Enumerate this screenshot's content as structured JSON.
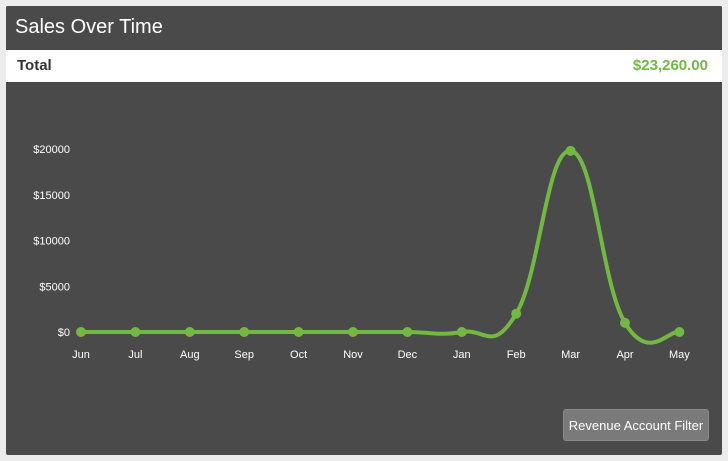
{
  "widget": {
    "title": "Sales Over Time",
    "total_label": "Total",
    "total_value": "$23,260.00",
    "filter_button_label": "Revenue Account Filter"
  },
  "colors": {
    "line": "#72b843",
    "panel": "#4a4a4a",
    "total_value": "#72b843"
  },
  "chart_data": {
    "type": "line",
    "title": "",
    "xlabel": "",
    "ylabel": "",
    "categories": [
      "Jun",
      "Jul",
      "Aug",
      "Sep",
      "Oct",
      "Nov",
      "Dec",
      "Jan",
      "Feb",
      "Mar",
      "Apr",
      "May"
    ],
    "series": [
      {
        "values": [
          0,
          0,
          0,
          0,
          0,
          0,
          0,
          0,
          2000,
          19800,
          1000,
          0
        ]
      }
    ],
    "y_ticks": [
      0,
      5000,
      10000,
      15000,
      20000
    ],
    "y_tick_labels": [
      "$0",
      "$5000",
      "$10000",
      "$15000",
      "$20000"
    ],
    "ylim": [
      0,
      20000
    ],
    "grid": false,
    "legend": "none",
    "smooth": true
  }
}
